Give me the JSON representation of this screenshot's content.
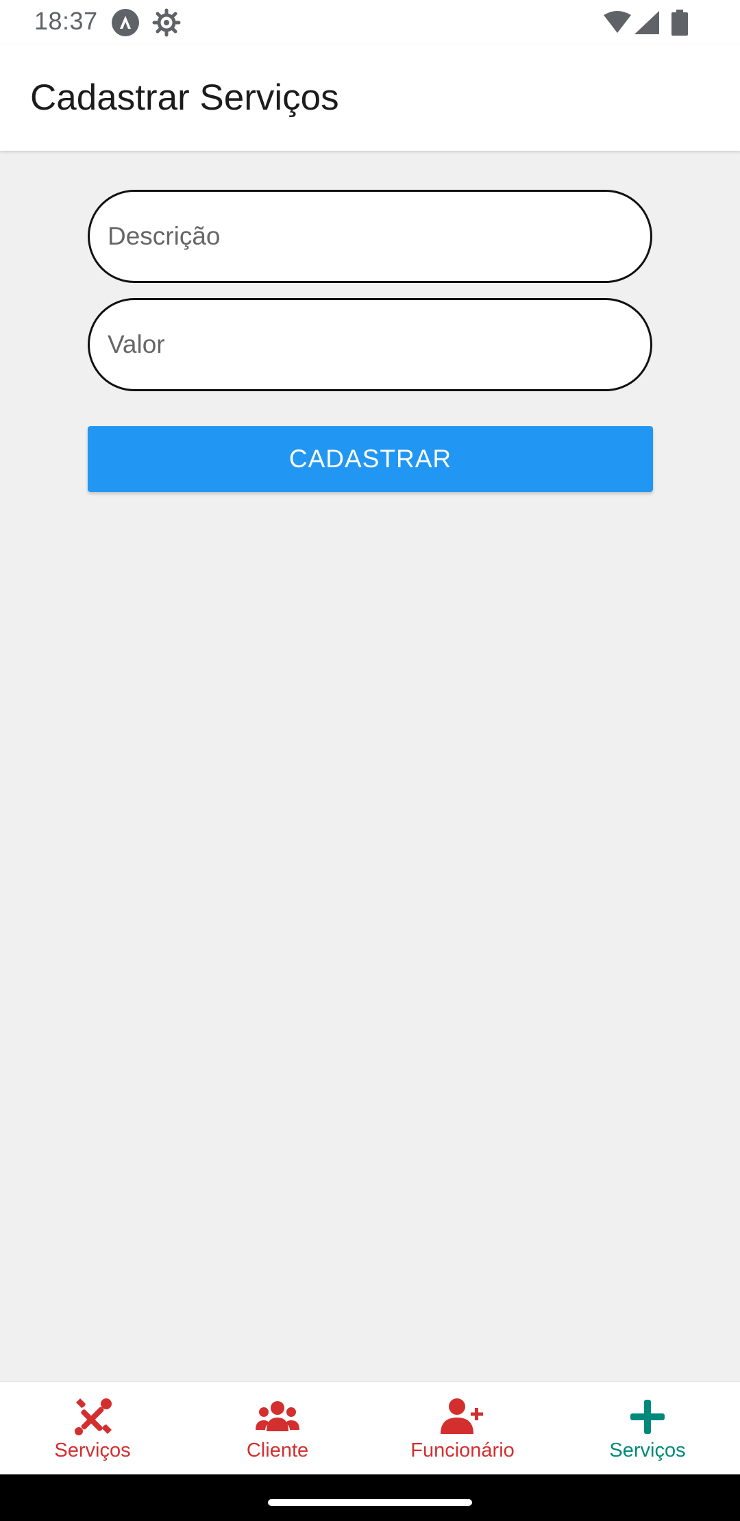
{
  "status_bar": {
    "time": "18:37",
    "icons": [
      "a-notification-icon",
      "gear-icon",
      "wifi-icon",
      "signal-icon",
      "battery-icon"
    ]
  },
  "app_bar": {
    "title": "Cadastrar Serviços"
  },
  "form": {
    "descricao": {
      "placeholder": "Descrição",
      "value": ""
    },
    "valor": {
      "placeholder": "Valor",
      "value": ""
    },
    "submit_label": "CADASTRAR"
  },
  "bottom_nav": {
    "items": [
      {
        "label": "Serviços",
        "icon": "tools-icon",
        "color": "#d32f2f"
      },
      {
        "label": "Cliente",
        "icon": "users-icon",
        "color": "#d32f2f"
      },
      {
        "label": "Funcionário",
        "icon": "user-plus-icon",
        "color": "#d32f2f"
      },
      {
        "label": "Serviços",
        "icon": "plus-icon",
        "color": "#00897b",
        "active": true
      }
    ]
  },
  "colors": {
    "primary_button": "#2196f3",
    "nav_inactive": "#d32f2f",
    "nav_active": "#00897b",
    "background": "#f0f0f0"
  }
}
